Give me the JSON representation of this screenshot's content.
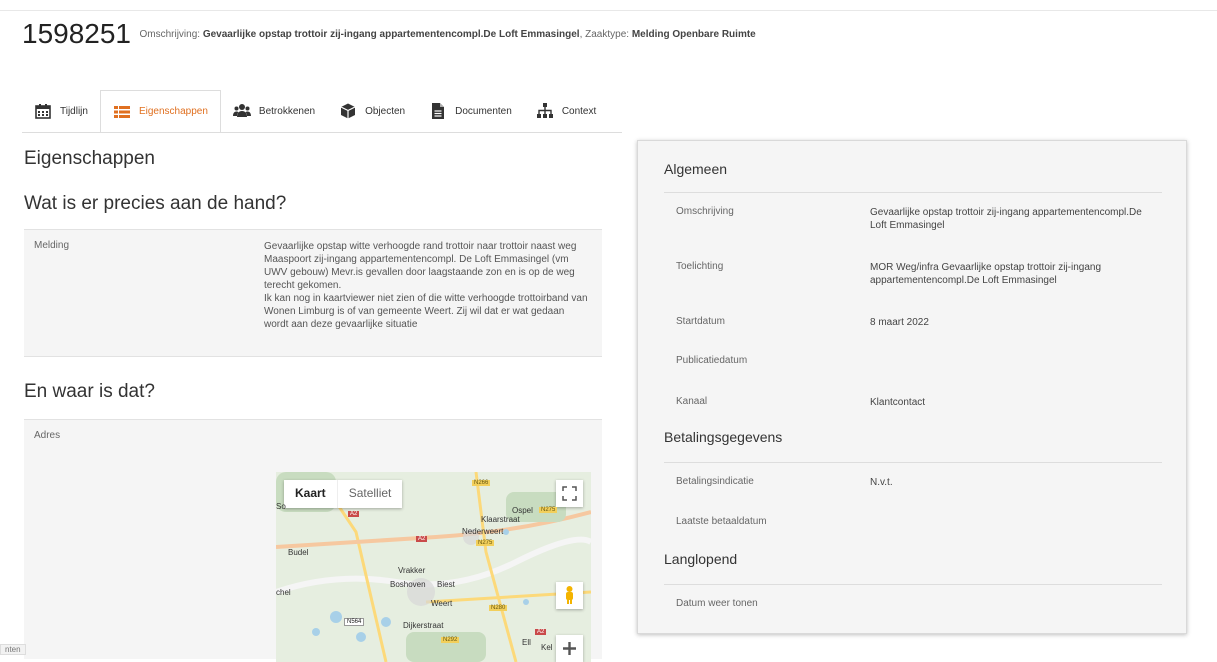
{
  "header": {
    "case_number": "1598251",
    "omschrijving_label": "Omschrijving:",
    "omschrijving_value": "Gevaarlijke opstap trottoir zij-ingang appartementencompl.De Loft Emmasingel",
    "zaaktype_label": "Zaaktype:",
    "zaaktype_value": "Melding Openbare Ruimte"
  },
  "tabs": [
    {
      "label": "Tijdlijn",
      "icon": "calendar-icon"
    },
    {
      "label": "Eigenschappen",
      "icon": "list-icon",
      "active": true
    },
    {
      "label": "Betrokkenen",
      "icon": "users-icon"
    },
    {
      "label": "Objecten",
      "icon": "cube-icon"
    },
    {
      "label": "Documenten",
      "icon": "document-icon"
    },
    {
      "label": "Context",
      "icon": "sitemap-icon"
    }
  ],
  "left": {
    "title": "Eigenschappen",
    "section1": "Wat is er precies aan de hand?",
    "melding_label": "Melding",
    "melding_text_1": "Gevaarlijke opstap witte verhoogde rand trottoir naar trottoir naast weg Maaspoort zij-ingang appartementencompl. De Loft Emmasingel (vm UWV gebouw) Mevr.is gevallen door laagstaande zon en is op de weg terecht gekomen.",
    "melding_text_2": "Ik kan nog in kaartviewer niet zien of die witte verhoogde trottoirband van Wonen Limburg is of van gemeente Weert. Zij wil dat er wat gedaan wordt aan deze gevaarlijke situatie",
    "section2": "En waar is dat?",
    "adres_label": "Adres"
  },
  "map": {
    "kaart": "Kaart",
    "satelliet": "Satelliet",
    "labels": [
      "Ospel",
      "Klaarstraat",
      "Nederweert",
      "Budel",
      "Vrakker",
      "Boshoven",
      "Biest",
      "Weert",
      "Dijkerstraat",
      "So",
      "chel",
      "Ell",
      "Kel"
    ],
    "roads": [
      "N266",
      "A2",
      "N275",
      "A2",
      "N275",
      "N280",
      "N564",
      "N292",
      "A2"
    ]
  },
  "panel": {
    "sec_algemeen": "Algemeen",
    "omschrijving_label": "Omschrijving",
    "omschrijving_value": "Gevaarlijke opstap trottoir zij-ingang appartementencompl.De Loft Emmasingel",
    "toelichting_label": "Toelichting",
    "toelichting_value": "MOR Weg/infra Gevaarlijke opstap trottoir zij-ingang appartementencompl.De Loft Emmasingel",
    "startdatum_label": "Startdatum",
    "startdatum_value": "8 maart 2022",
    "publicatiedatum_label": "Publicatiedatum",
    "kanaal_label": "Kanaal",
    "kanaal_value": "Klantcontact",
    "sec_betaling": "Betalingsgegevens",
    "betalingsindicatie_label": "Betalingsindicatie",
    "betalingsindicatie_value": "N.v.t.",
    "laatste_betaaldatum_label": "Laatste betaaldatum",
    "sec_langlopend": "Langlopend",
    "datum_weer_tonen_label": "Datum weer tonen"
  },
  "bottom": {
    "badge": "nten"
  },
  "colors": {
    "accent": "#e07020"
  }
}
